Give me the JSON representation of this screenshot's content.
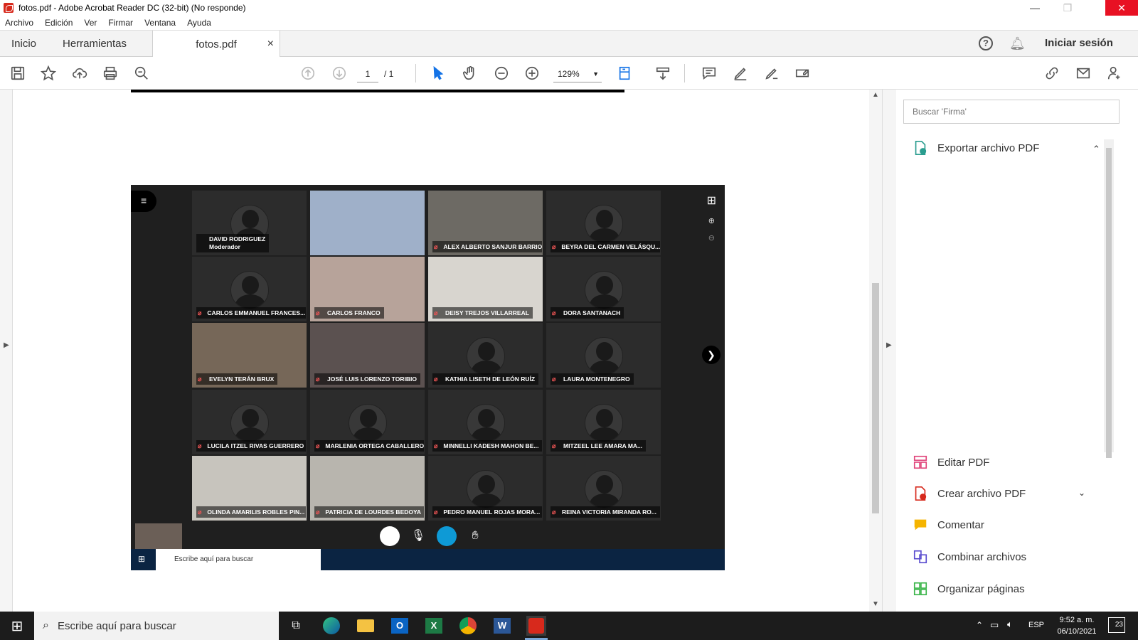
{
  "window": {
    "title": "fotos.pdf - Adobe Acrobat Reader DC (32-bit) (No responde)",
    "minimize": "—",
    "maximize": "❐",
    "close": "✕"
  },
  "menu": [
    "Archivo",
    "Edición",
    "Ver",
    "Firmar",
    "Ventana",
    "Ayuda"
  ],
  "tabs": {
    "home": "Inicio",
    "tools": "Herramientas",
    "document": "fotos.pdf",
    "close": "×",
    "signin": "Iniciar sesión"
  },
  "toolbar": {
    "page_current": "1",
    "page_total": "/ 1",
    "zoom": "129%"
  },
  "right_panel": {
    "search_placeholder": "Buscar 'Firma'",
    "export": "Exportar archivo PDF",
    "items": [
      "Editar PDF",
      "Crear archivo PDF",
      "Comentar",
      "Combinar archivos",
      "Organizar páginas"
    ]
  },
  "meeting": {
    "participants": [
      {
        "name": "DAVID RODRIGUEZ",
        "role": "Moderador",
        "video": false
      },
      {
        "name": "",
        "video": true
      },
      {
        "name": "ALEX ALBERTO SANJUR BARRIOS",
        "video": true
      },
      {
        "name": "BEYRA DEL CARMEN VELÁSQU...",
        "video": false
      },
      {
        "name": "CARLOS EMMANUEL FRANCES...",
        "video": false
      },
      {
        "name": "CARLOS FRANCO",
        "video": true
      },
      {
        "name": "DEISY TREJOS VILLARREAL",
        "video": true
      },
      {
        "name": "DORA SANTANACH",
        "video": false
      },
      {
        "name": "EVELYN TERÁN BRUX",
        "video": true
      },
      {
        "name": "JOSÉ LUIS LORENZO TORIBIO",
        "video": true
      },
      {
        "name": "KATHIA LISETH DE LEÓN RUÍZ",
        "video": false
      },
      {
        "name": "LAURA MONTENEGRO",
        "video": false
      },
      {
        "name": "LUCILA ITZEL RIVAS GUERRERO",
        "video": false
      },
      {
        "name": "MARLENIA ORTEGA CABALLERO",
        "video": false
      },
      {
        "name": "MINNELLI KADESH MAHON BE...",
        "video": false
      },
      {
        "name": "MITZEEL LEE AMARA MA...",
        "video": false
      },
      {
        "name": "OLINDA AMARILIS ROBLES PIN...",
        "video": true
      },
      {
        "name": "PATRICIA DE LOURDES BEDOYA",
        "video": true
      },
      {
        "name": "PEDRO MANUEL ROJAS MORA...",
        "video": false
      },
      {
        "name": "REINA VICTORIA MIRANDA RO...",
        "video": false
      }
    ],
    "inner_search": "Escribe aquí para buscar"
  },
  "taskbar": {
    "search": "Escribe aquí para buscar",
    "lang": "ESP",
    "time": "9:52 a. m.",
    "date": "06/10/2021",
    "notifications": "23"
  },
  "colors": {
    "accent": "#1473e6",
    "acrobat_red": "#d7291c",
    "meeting_bg": "#1f1f1f"
  }
}
